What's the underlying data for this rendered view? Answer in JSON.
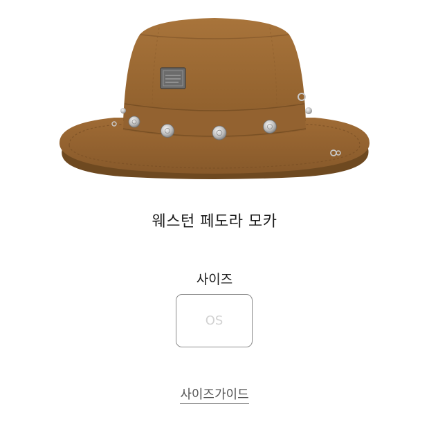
{
  "product": {
    "title": "웨스턴 페도라 모카",
    "image_icon": "bucket-hat-with-silver-conchos",
    "colors": {
      "hat": "#9a6a35",
      "hat_dark": "#6e4920",
      "hat_light": "#b07c43",
      "concho": "#cfcfcf",
      "patch": "#6b6b6b"
    }
  },
  "size": {
    "heading": "사이즈",
    "options": [
      {
        "label": "OS",
        "state": "unavailable"
      }
    ]
  },
  "size_guide": {
    "label": "사이즈가이드"
  }
}
